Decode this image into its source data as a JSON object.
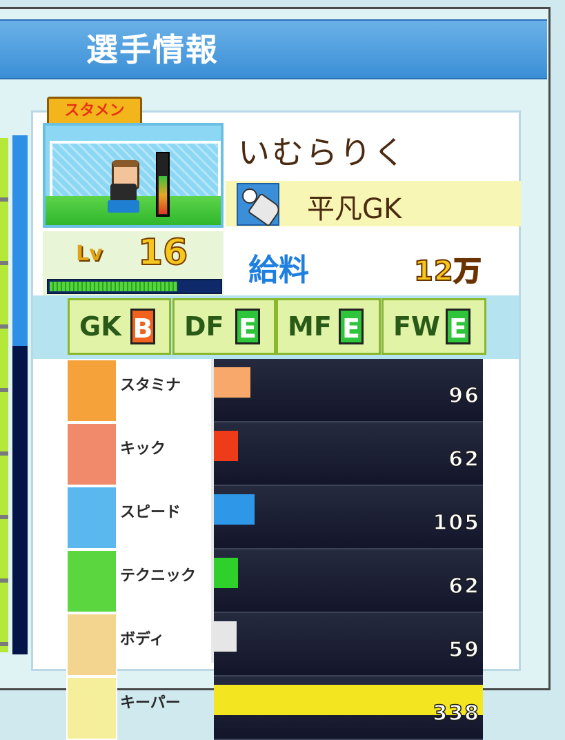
{
  "header": {
    "title": "選手情報"
  },
  "player": {
    "badge": "スタメン",
    "name": "いむらりく",
    "position": "平凡GK",
    "level_label": "Lv",
    "level": "16",
    "exp_fraction": 0.74,
    "salary_label": "給料",
    "salary_value": "12万"
  },
  "aptitudes": [
    {
      "pos": "GK",
      "grade": "B"
    },
    {
      "pos": "DF",
      "grade": "E"
    },
    {
      "pos": "MF",
      "grade": "E"
    },
    {
      "pos": "FW",
      "grade": "E"
    }
  ],
  "stats": [
    {
      "name": "スタミナ",
      "value": "96",
      "color": "#f7a86a",
      "icon": "battery-icon",
      "icon_bg": "#f6a23a"
    },
    {
      "name": "キック",
      "value": "62",
      "color": "#ee3b1a",
      "icon": "kick-icon",
      "icon_bg": "#f08a6a"
    },
    {
      "name": "スピード",
      "value": "105",
      "color": "#2e97e8",
      "icon": "running-icon",
      "icon_bg": "#5ab8ee"
    },
    {
      "name": "テクニック",
      "value": "62",
      "color": "#2fcf2c",
      "icon": "dribble-icon",
      "icon_bg": "#5bd63e"
    },
    {
      "name": "ボディ",
      "value": "59",
      "color": "#e6e6e6",
      "icon": "muscle-icon",
      "icon_bg": "#f4d58f"
    },
    {
      "name": "キーパー",
      "value": "338",
      "color": "#f3e51f",
      "icon": "goalkeeper-glove-icon",
      "icon_bg": "#f5ee9a"
    }
  ]
}
